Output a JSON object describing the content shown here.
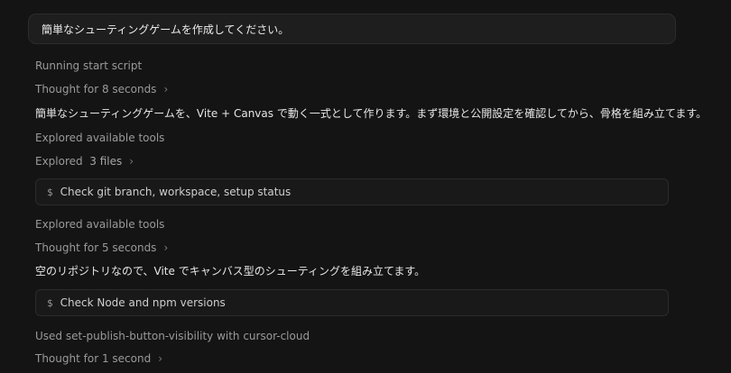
{
  "prompt": {
    "text": "簡単なシューティングゲームを作成してください。"
  },
  "steps": [
    {
      "kind": "status",
      "text": "Running start script"
    },
    {
      "kind": "thought",
      "text": "Thought for 8 seconds"
    },
    {
      "kind": "message",
      "text": "簡単なシューティングゲームを、Vite + Canvas で動く一式として作ります。まず環境と公開設定を確認してから、骨格を組み立てます。"
    },
    {
      "kind": "status",
      "text": "Explored available tools"
    },
    {
      "kind": "explored",
      "label": "Explored",
      "count": "3 files"
    },
    {
      "kind": "command",
      "symbol": "$",
      "text": "Check git branch, workspace, setup status"
    },
    {
      "kind": "status",
      "text": "Explored available tools"
    },
    {
      "kind": "thought",
      "text": "Thought for 5 seconds"
    },
    {
      "kind": "message",
      "text": "空のリポジトリなので、Vite でキャンバス型のシューティングを組み立てます。"
    },
    {
      "kind": "command",
      "symbol": "$",
      "text": "Check Node and npm versions"
    },
    {
      "kind": "status",
      "text": "Used set-publish-button-visibility with cursor-cloud"
    },
    {
      "kind": "thought",
      "text": "Thought for 1 second"
    }
  ],
  "icons": {
    "chevron": "›"
  }
}
